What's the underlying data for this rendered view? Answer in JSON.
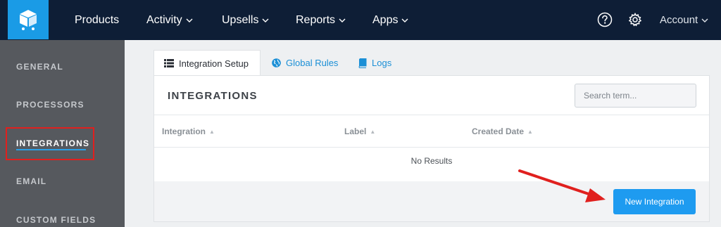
{
  "colors": {
    "topbar": "#0e1e36",
    "logo_bg": "#1a9be6",
    "sidebar": "#56595e",
    "accent": "#1e9bf0",
    "highlight": "#e0201e"
  },
  "nav": {
    "items": [
      {
        "label": "Products",
        "dropdown": false
      },
      {
        "label": "Activity",
        "dropdown": true
      },
      {
        "label": "Upsells",
        "dropdown": true
      },
      {
        "label": "Reports",
        "dropdown": true
      },
      {
        "label": "Apps",
        "dropdown": true
      }
    ],
    "help_icon": "question-circle-icon",
    "settings_icon": "gear-icon",
    "account_label": "Account"
  },
  "sidebar": {
    "items": [
      {
        "label": "GENERAL"
      },
      {
        "label": "PROCESSORS"
      },
      {
        "label": "INTEGRATIONS",
        "active": true
      },
      {
        "label": "EMAIL"
      },
      {
        "label": "CUSTOM FIELDS"
      }
    ]
  },
  "tabs": [
    {
      "label": "Integration Setup",
      "icon": "list-icon",
      "active": true
    },
    {
      "label": "Global Rules",
      "icon": "globe-icon"
    },
    {
      "label": "Logs",
      "icon": "book-icon"
    }
  ],
  "panel": {
    "title": "INTEGRATIONS",
    "search_placeholder": "Search term...",
    "columns": [
      "Integration",
      "Label",
      "Created Date"
    ],
    "empty_text": "No Results",
    "new_button": "New Integration"
  }
}
